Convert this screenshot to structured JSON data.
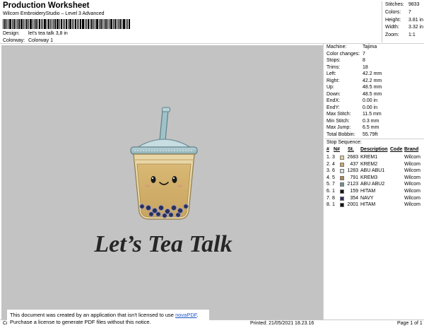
{
  "header": {
    "title": "Production Worksheet",
    "subtitle": "Wilcom EmbroideryStudio – Level 3 Advanced",
    "design_label": "Design:",
    "design_value": "let's tea talk 3,8 in",
    "colorway_label": "Colorway:",
    "colorway_value": "Colorway 1"
  },
  "summary": {
    "stitches_label": "Stitches:",
    "stitches": "9833",
    "colors_label": "Colors:",
    "colors": "7",
    "height_label": "Height:",
    "height": "3.81 in",
    "width_label": "Width:",
    "width": "3.32 in",
    "zoom_label": "Zoom:",
    "zoom": "1:1"
  },
  "machine_info": [
    {
      "label": "Machine:",
      "value": "Tajima"
    },
    {
      "label": "Color changes:",
      "value": "7"
    },
    {
      "label": "Stops:",
      "value": "8"
    },
    {
      "label": "Trims:",
      "value": "18"
    },
    {
      "label": "Left:",
      "value": "42.2 mm"
    },
    {
      "label": "Right:",
      "value": "42.2 mm"
    },
    {
      "label": "Up:",
      "value": "48.5 mm"
    },
    {
      "label": "Down:",
      "value": "48.5 mm"
    },
    {
      "label": "EndX:",
      "value": "0.00 in"
    },
    {
      "label": "EndY:",
      "value": "0.00 in"
    },
    {
      "label": "Max Stitch:",
      "value": "11.5 mm"
    },
    {
      "label": "Min Stitch:",
      "value": "0.3 mm"
    },
    {
      "label": "Max Jump:",
      "value": "6.5 mm"
    },
    {
      "label": "Total Bobbin:",
      "value": "55.79ft"
    }
  ],
  "stop_sequence": {
    "title": "Stop Sequence:",
    "headers": [
      "#",
      "N#",
      "St.",
      "Description",
      "Code",
      "Brand"
    ],
    "rows": [
      {
        "num": "1.",
        "n": "3",
        "st": "2683",
        "desc": "KREM1",
        "code": "",
        "brand": "Wilcom",
        "color": "#e6d0a0"
      },
      {
        "num": "2.",
        "n": "4",
        "st": "437",
        "desc": "KREM2",
        "code": "",
        "brand": "Wilcom",
        "color": "#c9a86a"
      },
      {
        "num": "3.",
        "n": "6",
        "st": "1283",
        "desc": "ABU ABU1",
        "code": "",
        "brand": "Wilcom",
        "color": "#d2dde0"
      },
      {
        "num": "4.",
        "n": "5",
        "st": "791",
        "desc": "KREM3",
        "code": "",
        "brand": "Wilcom",
        "color": "#a8874a"
      },
      {
        "num": "5.",
        "n": "7",
        "st": "2123",
        "desc": "ABU ABU2",
        "code": "",
        "brand": "Wilcom",
        "color": "#6f8f94"
      },
      {
        "num": "6.",
        "n": "1",
        "st": "159",
        "desc": "HITAM",
        "code": "",
        "brand": "Wilcom",
        "color": "#111111"
      },
      {
        "num": "7.",
        "n": "8",
        "st": "354",
        "desc": "NAVY",
        "code": "",
        "brand": "Wilcom",
        "color": "#2a2f5a"
      },
      {
        "num": "8.",
        "n": "1",
        "st": "2001",
        "desc": "HITAM",
        "code": "",
        "brand": "Wilcom",
        "color": "#111111"
      }
    ]
  },
  "design": {
    "text": "Let’s Tea Talk"
  },
  "footer": {
    "cr": "Cr",
    "printed": "Printed: 21/05/2021 18.23.16",
    "page": "Page 1 of 1"
  },
  "novapdf": {
    "line1_pre": "This document was created by an application that isn't licensed to use",
    "link": "novaPDF",
    "line1_post": ".",
    "line2": "Purchase a license to generate PDF files without this notice."
  }
}
